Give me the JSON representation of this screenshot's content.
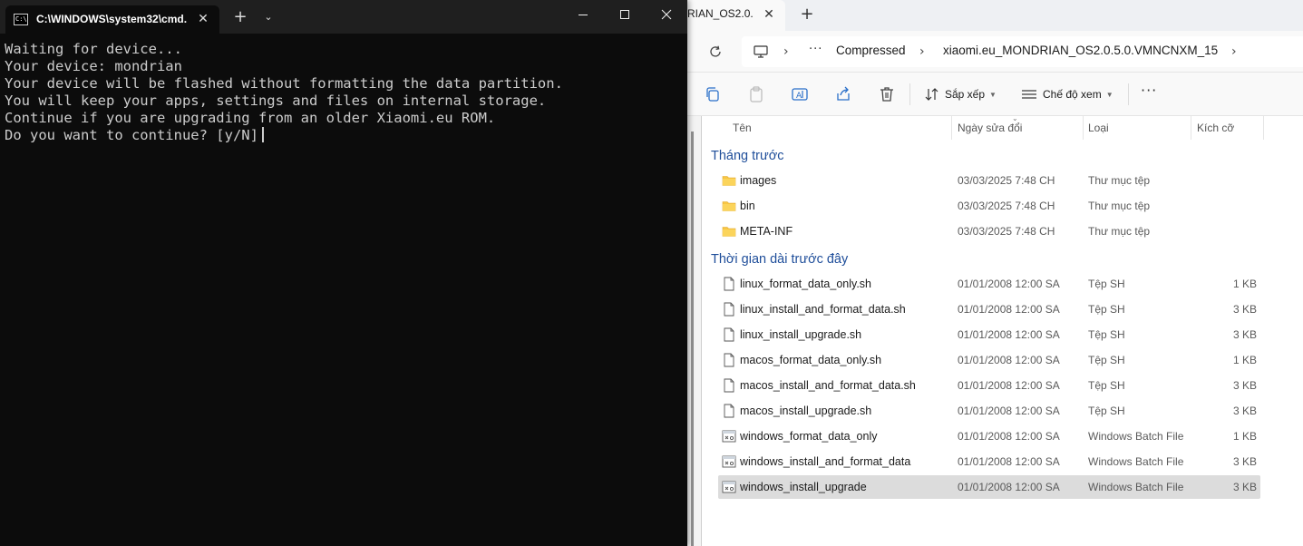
{
  "cmd": {
    "tab_title": "C:\\WINDOWS\\system32\\cmd.",
    "icon_glyph": "C:\\",
    "close_glyph": "✕",
    "newtab_glyph": "+",
    "dropdown_glyph": "⌄",
    "console_lines": [
      "Waiting for device...",
      "Your device: mondrian",
      "Your device will be flashed without formatting the data partition.",
      "You will keep your apps, settings and files on internal storage.",
      "Continue if you are upgrading from an older Xiaomi.eu ROM.",
      "Do you want to continue? [y/N]"
    ]
  },
  "explorer": {
    "tab_title": "RIAN_OS2.0.",
    "tab_close_glyph": "✕",
    "newtab_glyph": "+",
    "address": {
      "more_glyph": "···",
      "crumbs": [
        "Compressed",
        "xiaomi.eu_MONDRIAN_OS2.0.5.0.VMNCNXM_15"
      ]
    },
    "toolbar": {
      "sort_label": "Sắp xếp",
      "view_label": "Chế độ xem",
      "more_glyph": "···"
    },
    "columns": {
      "name": "Tên",
      "date": "Ngày sửa đổi",
      "type": "Loại",
      "size": "Kích cỡ"
    },
    "groups": [
      {
        "title": "Tháng trước",
        "items": [
          {
            "name": "images",
            "date": "03/03/2025 7:48 CH",
            "type": "Thư mục tệp",
            "size": "",
            "icon": "folder-icon"
          },
          {
            "name": "bin",
            "date": "03/03/2025 7:48 CH",
            "type": "Thư mục tệp",
            "size": "",
            "icon": "folder-icon"
          },
          {
            "name": "META-INF",
            "date": "03/03/2025 7:48 CH",
            "type": "Thư mục tệp",
            "size": "",
            "icon": "folder-icon"
          }
        ]
      },
      {
        "title": "Thời gian dài trước đây",
        "items": [
          {
            "name": "linux_format_data_only.sh",
            "date": "01/01/2008 12:00 SA",
            "type": "Tệp SH",
            "size": "1 KB",
            "icon": "file-icon"
          },
          {
            "name": "linux_install_and_format_data.sh",
            "date": "01/01/2008 12:00 SA",
            "type": "Tệp SH",
            "size": "3 KB",
            "icon": "file-icon"
          },
          {
            "name": "linux_install_upgrade.sh",
            "date": "01/01/2008 12:00 SA",
            "type": "Tệp SH",
            "size": "3 KB",
            "icon": "file-icon"
          },
          {
            "name": "macos_format_data_only.sh",
            "date": "01/01/2008 12:00 SA",
            "type": "Tệp SH",
            "size": "1 KB",
            "icon": "file-icon"
          },
          {
            "name": "macos_install_and_format_data.sh",
            "date": "01/01/2008 12:00 SA",
            "type": "Tệp SH",
            "size": "3 KB",
            "icon": "file-icon"
          },
          {
            "name": "macos_install_upgrade.sh",
            "date": "01/01/2008 12:00 SA",
            "type": "Tệp SH",
            "size": "3 KB",
            "icon": "file-icon"
          },
          {
            "name": "windows_format_data_only",
            "date": "01/01/2008 12:00 SA",
            "type": "Windows Batch File",
            "size": "1 KB",
            "icon": "batch-file-icon"
          },
          {
            "name": "windows_install_and_format_data",
            "date": "01/01/2008 12:00 SA",
            "type": "Windows Batch File",
            "size": "3 KB",
            "icon": "batch-file-icon"
          },
          {
            "name": "windows_install_upgrade",
            "date": "01/01/2008 12:00 SA",
            "type": "Windows Batch File",
            "size": "3 KB",
            "icon": "batch-file-icon",
            "selected": true
          }
        ]
      }
    ]
  },
  "colors": {
    "console_bg": "#0c0c0c",
    "console_text": "#cccccc",
    "group_header": "#1f4e9a",
    "selection": "#dcdcdc",
    "folder": "#f8c644"
  }
}
